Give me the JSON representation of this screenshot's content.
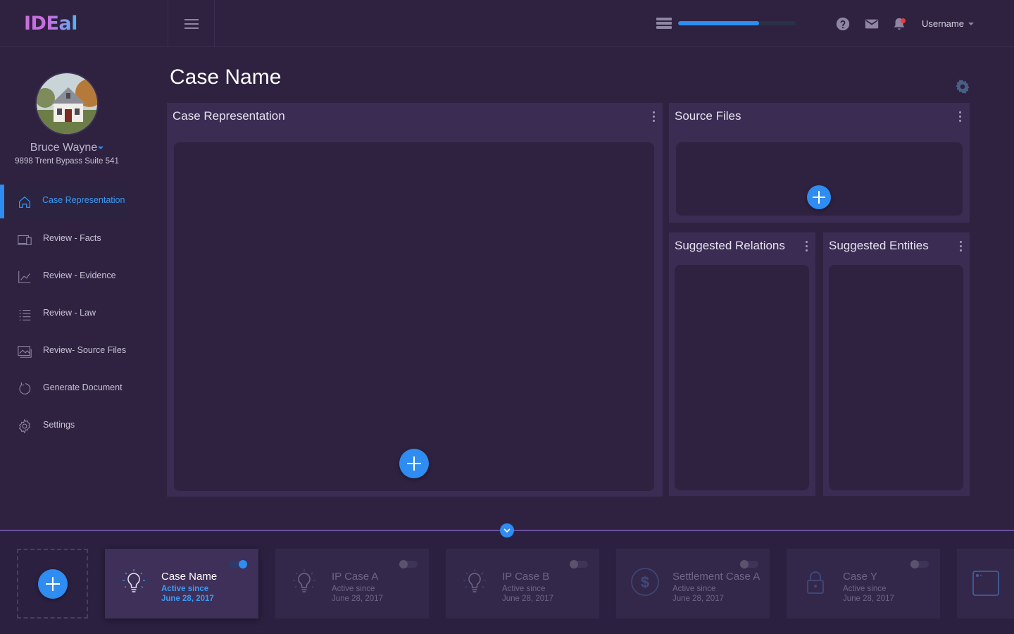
{
  "app": {
    "logo": "IDEal"
  },
  "header": {
    "username": "Username",
    "progress_fraction": 0.69
  },
  "profile": {
    "name": "Bruce Wayne",
    "address": "9898 Trent Bypass Suite 541"
  },
  "sidebar": {
    "items": [
      {
        "label": "Case Representation",
        "icon": "home-icon",
        "active": true
      },
      {
        "label": "Review - Facts",
        "icon": "devices-icon",
        "active": false
      },
      {
        "label": "Review - Evidence",
        "icon": "line-chart-icon",
        "active": false
      },
      {
        "label": "Review - Law",
        "icon": "list-icon",
        "active": false
      },
      {
        "label": "Review- Source Files",
        "icon": "gallery-icon",
        "active": false
      },
      {
        "label": "Generate Document",
        "icon": "refresh-icon",
        "active": false
      },
      {
        "label": "Settings",
        "icon": "gear-icon",
        "active": false
      }
    ]
  },
  "main": {
    "title": "Case Name",
    "panels": {
      "case_representation": "Case Representation",
      "source_files": "Source Files",
      "suggested_relations": "Suggested Relations",
      "suggested_entities": "Suggested Entities"
    }
  },
  "cases": [
    {
      "title": "Case Name",
      "active_label": "Active since",
      "date": "June 28, 2017",
      "icon": "lightbulb-icon",
      "enabled": true
    },
    {
      "title": "IP Case A",
      "active_label": "Active since",
      "date": "June 28, 2017",
      "icon": "lightbulb-icon",
      "enabled": false
    },
    {
      "title": "IP Case B",
      "active_label": "Active since",
      "date": "June 28, 2017",
      "icon": "lightbulb-icon",
      "enabled": false
    },
    {
      "title": "Settlement Case A",
      "active_label": "Active since",
      "date": "June 28, 2017",
      "icon": "dollar-icon",
      "enabled": false
    },
    {
      "title": "Case Y",
      "active_label": "Active since",
      "date": "June 28, 2017",
      "icon": "lock-icon",
      "enabled": false
    }
  ],
  "colors": {
    "background": "#2e2240",
    "accent": "#2f8cf0",
    "panel": "#3a2c52",
    "tray_line": "#6b4fa0"
  }
}
